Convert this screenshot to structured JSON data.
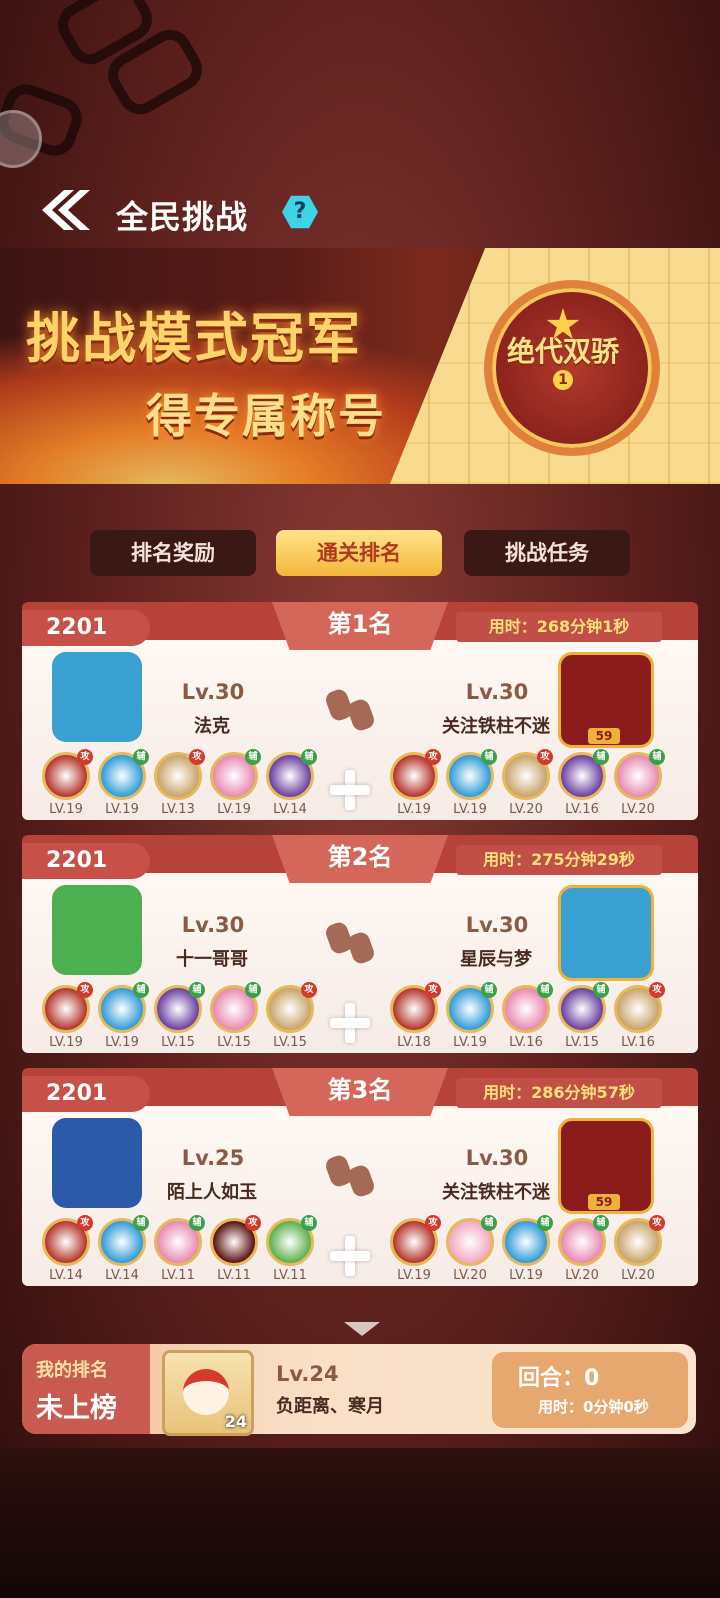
{
  "header": {
    "title": "全民挑战",
    "help": "?"
  },
  "banner": {
    "line1": "挑战模式冠军",
    "line2": "得专属称号",
    "medal_text": "绝代双骄",
    "medal_num": "1"
  },
  "tabs": [
    {
      "label": "排名奖励"
    },
    {
      "label": "通关排名"
    },
    {
      "label": "挑战任务"
    }
  ],
  "active_tab": "通关排名",
  "rankings": [
    {
      "score": "2201",
      "rank": "第1名",
      "time": "用时：268分钟1秒",
      "left": {
        "level": "Lv.30",
        "name": "法克",
        "avatar_color": "#3a9fd1",
        "pets": [
          {
            "lv": "LV.19",
            "tag": "攻",
            "color": "#b3342a"
          },
          {
            "lv": "LV.19",
            "tag": "辅",
            "color": "#2e9bd8"
          },
          {
            "lv": "LV.13",
            "tag": "攻",
            "color": "#c9a46a"
          },
          {
            "lv": "LV.19",
            "tag": "辅",
            "color": "#e889b0"
          },
          {
            "lv": "LV.14",
            "tag": "辅",
            "color": "#6a3fa0"
          }
        ]
      },
      "right": {
        "level": "Lv.30",
        "name": "关注铁柱不迷",
        "avatar_color": "#8a1c1c",
        "badge": "59",
        "pets": [
          {
            "lv": "LV.19",
            "tag": "攻",
            "color": "#b3342a"
          },
          {
            "lv": "LV.19",
            "tag": "辅",
            "color": "#2e9bd8"
          },
          {
            "lv": "LV.20",
            "tag": "攻",
            "color": "#c9a46a"
          },
          {
            "lv": "LV.16",
            "tag": "辅",
            "color": "#6a3fa0"
          },
          {
            "lv": "LV.20",
            "tag": "辅",
            "color": "#e889b0"
          }
        ]
      }
    },
    {
      "score": "2201",
      "rank": "第2名",
      "time": "用时：275分钟29秒",
      "left": {
        "level": "Lv.30",
        "name": "十一哥哥",
        "avatar_color": "#4caf50",
        "pets": [
          {
            "lv": "LV.19",
            "tag": "攻",
            "color": "#b3342a"
          },
          {
            "lv": "LV.19",
            "tag": "辅",
            "color": "#2e9bd8"
          },
          {
            "lv": "LV.15",
            "tag": "辅",
            "color": "#6a3fa0"
          },
          {
            "lv": "LV.15",
            "tag": "辅",
            "color": "#e889b0"
          },
          {
            "lv": "LV.15",
            "tag": "攻",
            "color": "#c9a46a"
          }
        ]
      },
      "right": {
        "level": "Lv.30",
        "name": "星辰与梦",
        "avatar_color": "#3a9fd1",
        "pets": [
          {
            "lv": "LV.18",
            "tag": "攻",
            "color": "#b3342a"
          },
          {
            "lv": "LV.19",
            "tag": "辅",
            "color": "#2e9bd8"
          },
          {
            "lv": "LV.16",
            "tag": "辅",
            "color": "#e889b0"
          },
          {
            "lv": "LV.15",
            "tag": "辅",
            "color": "#6a3fa0"
          },
          {
            "lv": "LV.16",
            "tag": "攻",
            "color": "#c9a46a"
          }
        ]
      }
    },
    {
      "score": "2201",
      "rank": "第3名",
      "time": "用时：286分钟57秒",
      "left": {
        "level": "Lv.25",
        "name": "陌上人如玉",
        "avatar_color": "#2a5aa8",
        "pets": [
          {
            "lv": "LV.14",
            "tag": "攻",
            "color": "#b3342a"
          },
          {
            "lv": "LV.14",
            "tag": "辅",
            "color": "#2e9bd8"
          },
          {
            "lv": "LV.11",
            "tag": "辅",
            "color": "#e889b0"
          },
          {
            "lv": "LV.11",
            "tag": "攻",
            "color": "#5a1010"
          },
          {
            "lv": "LV.11",
            "tag": "辅",
            "color": "#5cb04a"
          }
        ]
      },
      "right": {
        "level": "Lv.30",
        "name": "关注铁柱不迷",
        "avatar_color": "#8a1c1c",
        "badge": "59",
        "pets": [
          {
            "lv": "LV.19",
            "tag": "攻",
            "color": "#b3342a"
          },
          {
            "lv": "LV.20",
            "tag": "辅",
            "color": "#f2a9c3"
          },
          {
            "lv": "LV.19",
            "tag": "辅",
            "color": "#2e9bd8"
          },
          {
            "lv": "LV.20",
            "tag": "辅",
            "color": "#e889b0"
          },
          {
            "lv": "LV.20",
            "tag": "攻",
            "color": "#c9a46a"
          }
        ]
      }
    }
  ],
  "my_rank": {
    "label": "我的排名",
    "status": "未上榜",
    "level": "Lv.24",
    "name": "负距离、寒月",
    "avatar_badge": "24",
    "rounds": "回合：0",
    "time": "用时：0分钟0秒"
  }
}
